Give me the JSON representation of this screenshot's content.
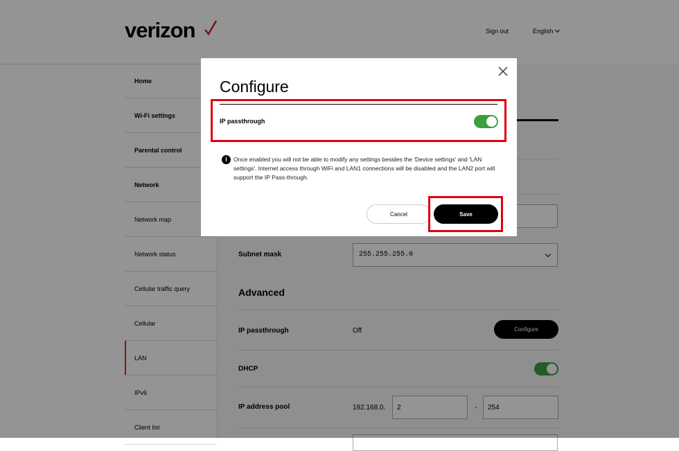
{
  "header": {
    "logo": "verizon",
    "sign_out": "Sign out",
    "language": "English"
  },
  "sidebar": {
    "items": [
      {
        "label": "Home"
      },
      {
        "label": "Wi-Fi settings"
      },
      {
        "label": "Parental control"
      },
      {
        "label": "Network"
      },
      {
        "label": "Network map"
      },
      {
        "label": "Network status"
      },
      {
        "label": "Cellular traffic query"
      },
      {
        "label": "Cellular"
      },
      {
        "label": "LAN"
      },
      {
        "label": "IPv6"
      },
      {
        "label": "Client list"
      }
    ],
    "active": "LAN"
  },
  "main": {
    "subnet_mask_label": "Subnet mask",
    "subnet_mask_value": "255.255.255.0",
    "advanced_heading": "Advanced",
    "ip_passthrough_label": "IP passthrough",
    "ip_passthrough_value": "Off",
    "configure_button": "Configure",
    "dhcp_label": "DHCP",
    "dhcp_enabled": true,
    "ip_pool_label": "IP address pool",
    "ip_pool_prefix": "192.168.0.",
    "ip_pool_start": "2",
    "ip_pool_separator": "-",
    "ip_pool_end": "254"
  },
  "modal": {
    "title": "Configure",
    "ip_passthrough_label": "IP passthrough",
    "ip_passthrough_enabled": true,
    "info_icon": "i",
    "info_text": "Once enabled you will not be able to modify any settings besides the 'Device settings' and 'LAN settings'. Internet access through WiFi and LAN1 connections will be disabled and the LAN2 port will support the IP Pass-through.",
    "cancel_button": "Cancel",
    "save_button": "Save"
  },
  "colors": {
    "brand_red": "#d52b1e",
    "toggle_on": "#3e9e3e",
    "highlight": "#e00010"
  }
}
